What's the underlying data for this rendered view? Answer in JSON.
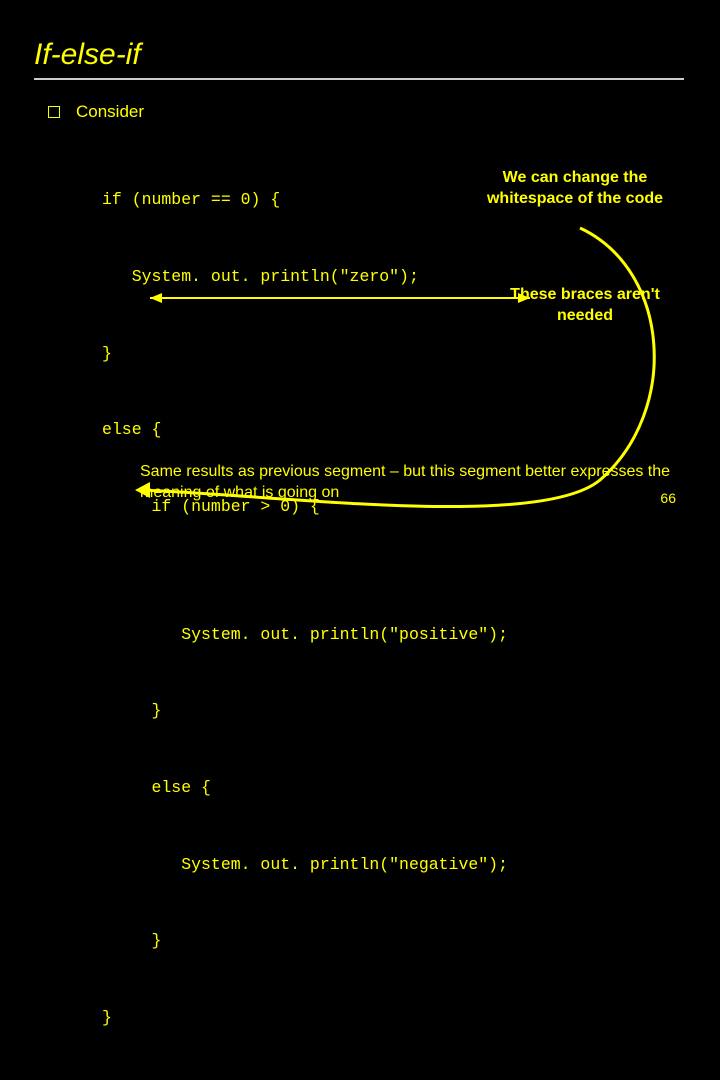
{
  "title": "If-else-if",
  "bullet": "Consider",
  "code_lines": [
    "if (number == 0) {",
    "   System. out. println(\"zero\");",
    "}",
    "else {",
    "     if (number > 0) {",
    "",
    "        System. out. println(\"positive\");",
    "     }",
    "     else {",
    "        System. out. println(\"negative\");",
    "     }",
    "}"
  ],
  "annotations": {
    "whitespace": "We can change the whitespace of the code",
    "braces": "These braces aren't needed"
  },
  "bottom_note": "Same results as previous segment – but this segment better expresses the meaning of what is going on",
  "page_number": "66"
}
